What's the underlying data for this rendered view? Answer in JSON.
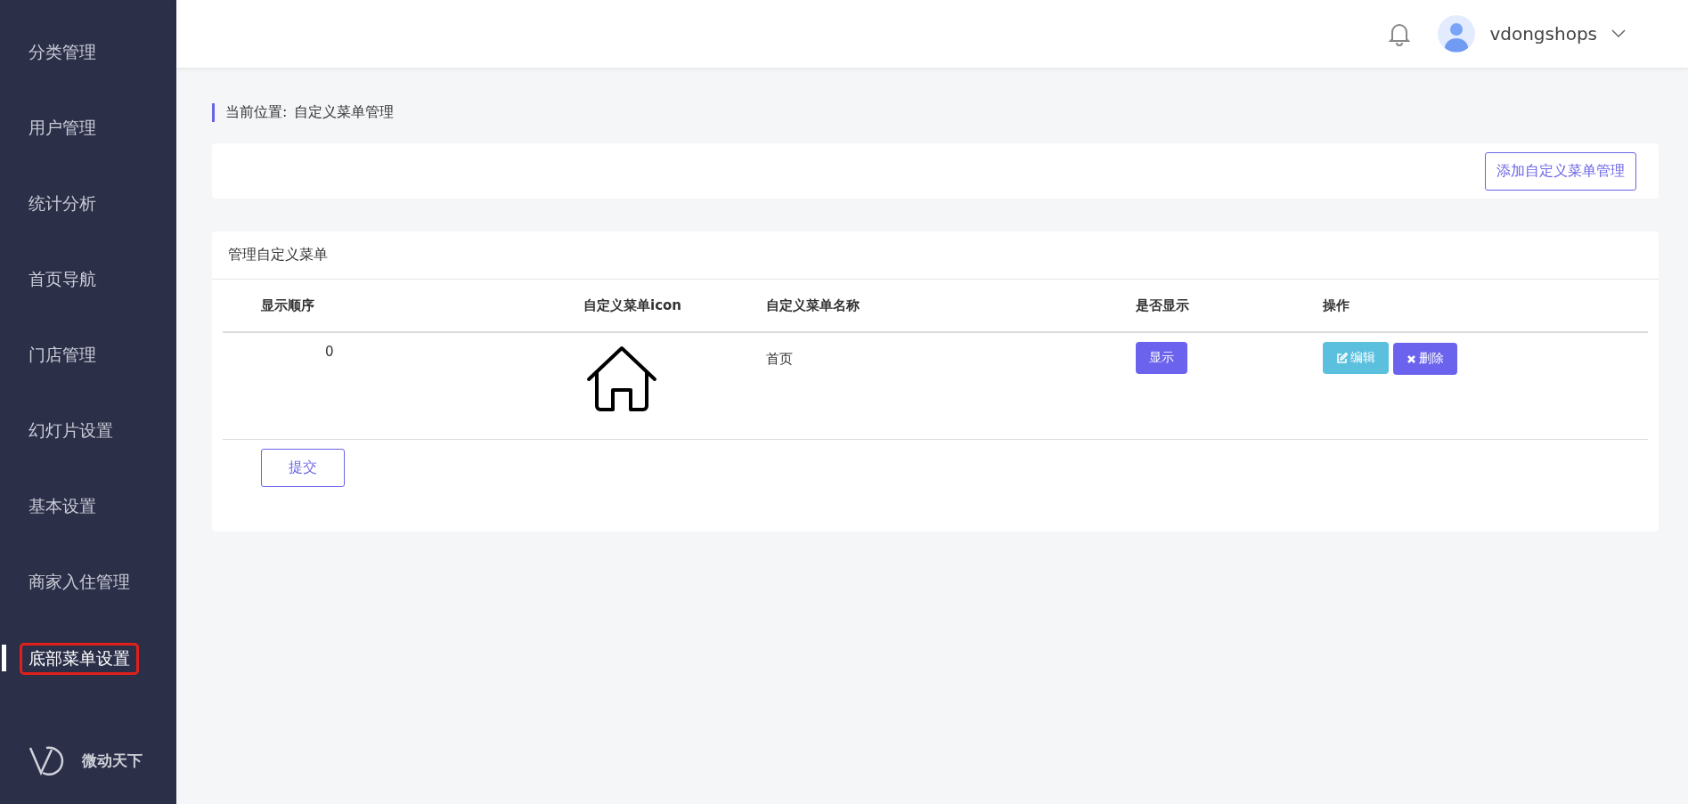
{
  "sidebar": {
    "items": [
      {
        "label": "分类管理",
        "selected": false
      },
      {
        "label": "用户管理",
        "selected": false
      },
      {
        "label": "统计分析",
        "selected": false
      },
      {
        "label": "首页导航",
        "selected": false
      },
      {
        "label": "门店管理",
        "selected": false
      },
      {
        "label": "幻灯片设置",
        "selected": false
      },
      {
        "label": "基本设置",
        "selected": false
      },
      {
        "label": "商家入住管理",
        "selected": false
      },
      {
        "label": "底部菜单设置",
        "selected": true
      }
    ],
    "brand": "微动天下"
  },
  "header": {
    "username": "vdongshops"
  },
  "breadcrumb": {
    "label": "当前位置:",
    "current": "自定义菜单管理"
  },
  "toolbar": {
    "add_button": "添加自定义菜单管理"
  },
  "panel": {
    "title": "管理自定义菜单",
    "table": {
      "columns": [
        "显示顺序",
        "自定义菜单icon",
        "自定义菜单名称",
        "是否显示",
        "操作"
      ],
      "rows": [
        {
          "order": "0",
          "name": "首页",
          "visible_button": "显示",
          "edit_button": "编辑",
          "delete_button": "删除"
        }
      ]
    },
    "submit_button": "提交"
  }
}
